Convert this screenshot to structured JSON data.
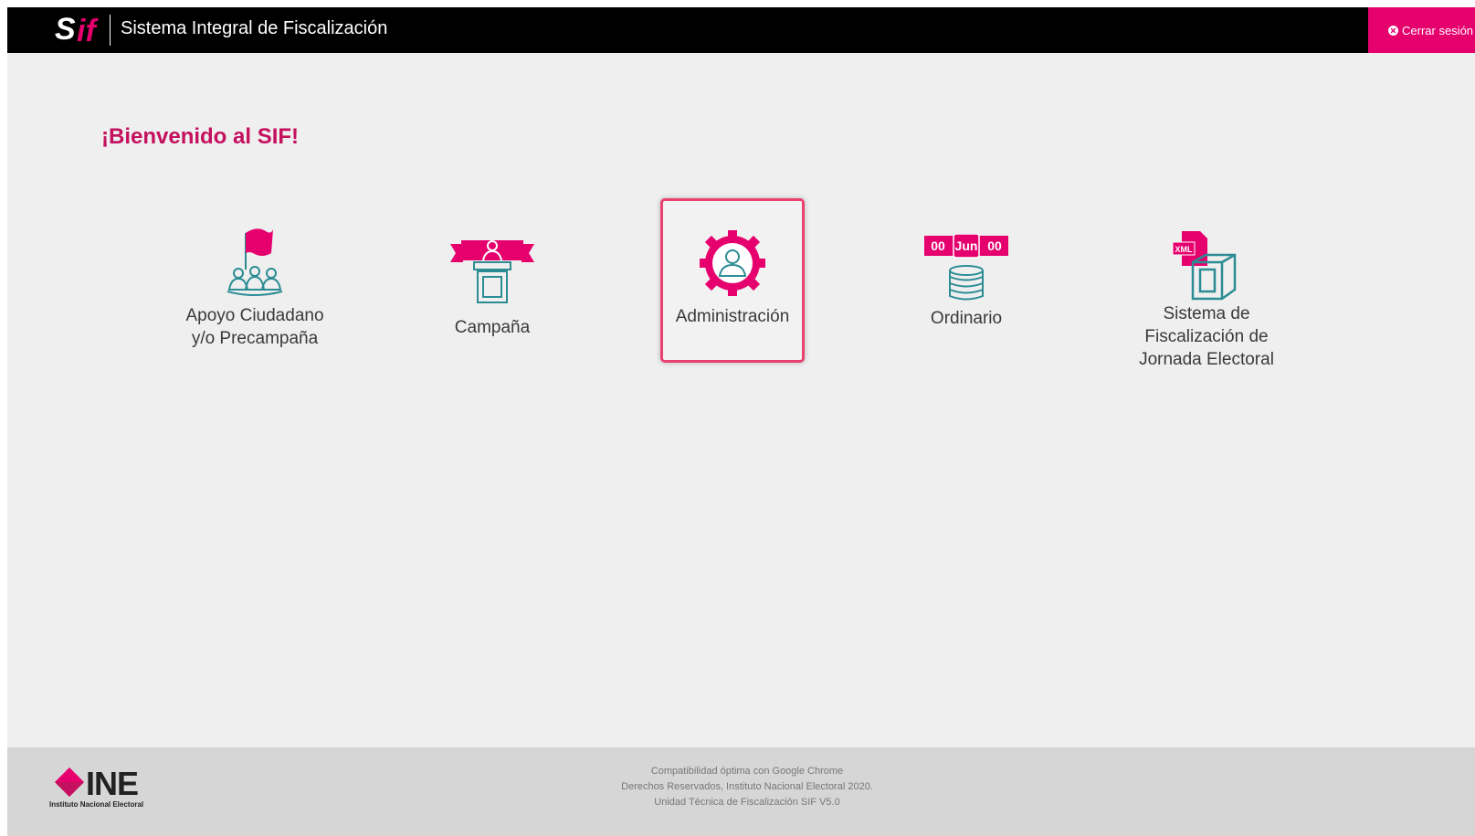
{
  "header": {
    "title": "Sistema Integral de Fiscalización",
    "logo_s": "S",
    "logo_if": "if",
    "logout_label": "Cerrar sesión"
  },
  "welcome": "¡Bienvenido al SIF!",
  "modules": [
    {
      "label_lines": [
        "Apoyo Ciudadano",
        "y/o Precampaña"
      ],
      "icon": "flag-people-icon"
    },
    {
      "label_lines": [
        "Campaña"
      ],
      "icon": "podium-icon"
    },
    {
      "label_lines": [
        "Administración"
      ],
      "icon": "admin-gear-icon",
      "selected": true
    },
    {
      "label_lines": [
        "Ordinario"
      ],
      "icon": "coins-calendar-icon",
      "calendar": [
        "00",
        "Jun",
        "00"
      ]
    },
    {
      "label_lines": [
        "Sistema de",
        "Fiscalización de",
        "Jornada Electoral"
      ],
      "icon": "xml-ballot-box-icon",
      "badge": "XML"
    }
  ],
  "footer": {
    "logo_text": "INE",
    "logo_subtext": "Instituto Nacional Electoral",
    "lines": [
      "Compatibilidad óptima con Google Chrome",
      "Derechos Reservados, Instituto Nacional Electoral 2020.",
      "Unidad Técnica de Fiscalización SIF V5.0"
    ]
  },
  "colors": {
    "brand_pink": "#e5006d",
    "welcome_pink": "#c4105e",
    "icon_teal": "#2b8c94",
    "header_bg": "#000000",
    "page_bg": "#efefef",
    "footer_bg": "#d6d6d6"
  }
}
